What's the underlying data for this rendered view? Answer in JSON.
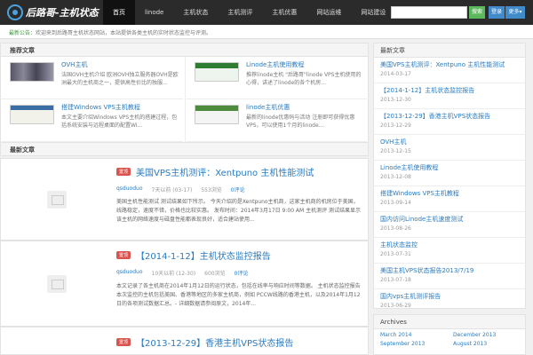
{
  "header": {
    "logo_text": "后路哥-主机状态",
    "nav": [
      "首页",
      "linode",
      "主机状态",
      "主机测评",
      "主机优惠",
      "网站运维",
      "网站建设"
    ],
    "search_placeholder": "",
    "search_label": "搜索",
    "login_label": "登录",
    "more_label": "更多"
  },
  "notice": {
    "highlight": "最新公告：",
    "text": "欢迎来到后路哥主机状态网站，本站提供各类主机的实时状态监控与评测。"
  },
  "featured": {
    "heading": "推荐文章",
    "items": [
      {
        "title": "OVH主机",
        "desc": "法国OVH主机介绍 欧洲OVH独立服务器OVH是欧洲最大的主机商之一，提供高性价比的独服..."
      },
      {
        "title": "Linode主机使用教程",
        "desc": "推荐linode主机 \"后路哥\"linode VPS主机使用的心得，讲述了linode的各个机房..."
      },
      {
        "title": "搭建Windows VPS主机教程",
        "desc": "本文主要介绍Windows VPS主机的搭建过程，包括系统安装与远程桌面的配置Wi..."
      },
      {
        "title": "linode主机优惠",
        "desc": "最新的linode优惠码与活动 注册即可获得优惠VPS，可以使用1个月的linode..."
      }
    ]
  },
  "posts_heading": "最新文章",
  "posts": [
    {
      "tag": "置顶",
      "title": "美国VPS主机测评：Xentpuno 主机性能测试",
      "author": "qsduoduo",
      "date": "7天以前 (03-17)",
      "views": "553浏览",
      "comments": "0评论",
      "body": "美国主机性能测试 测试结果如下所示。 今天介绍的是Xentpuno主机商，这家主机商的机房位于美国，线路稳定，速度不错，价格也比较实惠。 发布时间：2014年3月17日 9:00 AM 主机测评 测试结果显示该主机的网络速度与磁盘性能都表现良好，适合建站使用..."
    },
    {
      "tag": "置顶",
      "title": "【2014-1-12】主机状态监控报告",
      "author": "qsduoduo",
      "date": "10天以前 (12-30)",
      "views": "600浏览",
      "comments": "0评论",
      "body": "本文记录了各主机商在2014年1月12日的运行状态，包括在线率与响应时间等数据。 主机状态监控报告 本次监控的主机包括美国、香港等地区的多家主机商，例如 PCCW线路的香港主机，以及2014年1月12日的各项测试数据汇总。- 详细数据请参阅原文，2014年..."
    },
    {
      "tag": "置顶",
      "title": "【2013-12-29】香港主机VPS状态报告",
      "author": "qsduoduo",
      "date": "",
      "views": "",
      "comments": "",
      "body": ""
    }
  ],
  "sidebar": {
    "recent_heading": "最新文章",
    "recent": [
      {
        "title": "美国VPS主机测评：Xentpuno 主机性能测试",
        "date": "2014-03-17"
      },
      {
        "title": "【2014-1-12】主机状态监控报告",
        "date": "2013-12-30"
      },
      {
        "title": "【2013-12-29】香港主机VPS状态报告",
        "date": "2013-12-29"
      },
      {
        "title": "OVH主机",
        "date": "2013-12-15"
      },
      {
        "title": "Linode主机使用教程",
        "date": "2013-12-08"
      },
      {
        "title": "搭建Windows VPS主机教程",
        "date": "2013-09-14"
      },
      {
        "title": "国内访问Linode主机速度测试",
        "date": "2013-08-26"
      },
      {
        "title": "主机状态监控",
        "date": "2013-07-31"
      },
      {
        "title": "美国主机VPS状态报告2013/7/19",
        "date": "2013-07-18"
      },
      {
        "title": "国内vps主机测评报告",
        "date": "2013-06-29"
      }
    ],
    "archives_heading": "Archives",
    "archives": [
      "March 2014",
      "December 2013",
      "September 2013",
      "August 2013"
    ]
  },
  "colors": {
    "header_bg": "#2b2b2b",
    "link": "#2a7bc0",
    "tag": "#d9534f",
    "search_btn": "#5cb85c",
    "login_btn": "#428bca"
  }
}
